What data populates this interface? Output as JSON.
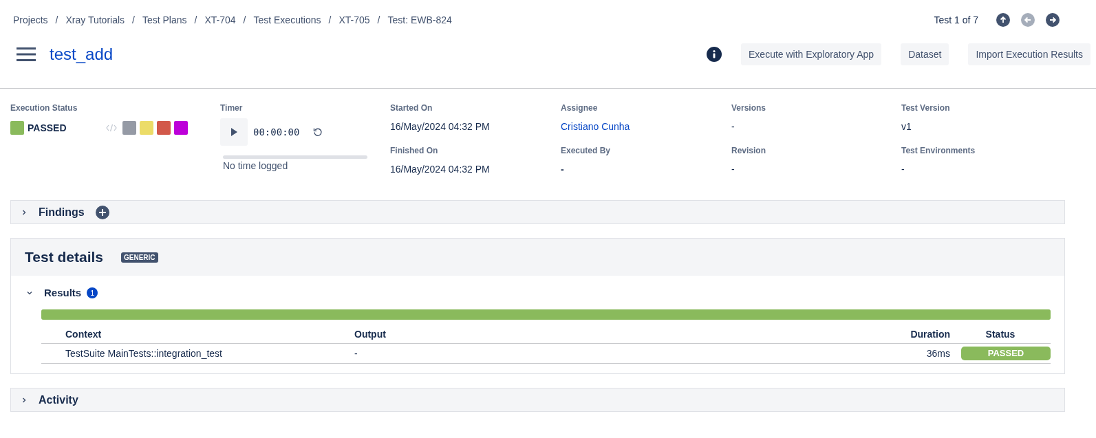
{
  "breadcrumbs": [
    {
      "label": "Projects"
    },
    {
      "separator": "/",
      "label": "Xray Tutorials"
    },
    {
      "separator": "/",
      "label": "Test Plans"
    },
    {
      "separator": "/",
      "label": "XT-704"
    },
    {
      "separator": "/",
      "label": "Test Executions"
    },
    {
      "separator": "/",
      "label": "XT-705"
    },
    {
      "separator": "/",
      "label": "Test: EWB-824"
    }
  ],
  "pager": {
    "label": "Test 1 of 7",
    "buttons": [
      {
        "kind": "up",
        "disabled": false
      },
      {
        "kind": "prev",
        "disabled": true
      },
      {
        "kind": "next",
        "disabled": false
      }
    ]
  },
  "title": "test_add",
  "actions": [
    "Execute with Exploratory App",
    "Dataset",
    "Import Execution Results"
  ],
  "execution_status": {
    "label": "Execution Status",
    "value": "PASSED",
    "color": "#8aba5c",
    "options": [
      {
        "color": "#959aa5"
      },
      {
        "color": "#ecdc68"
      },
      {
        "color": "#d2594a"
      },
      {
        "color": "#bd00d9"
      }
    ]
  },
  "timer": {
    "label": "Timer",
    "time": "00:00:00",
    "level": 0,
    "note": "No time logged"
  },
  "fields": [
    {
      "label": "Started On",
      "value": "16/May/2024 04:32 PM",
      "kind": "text"
    },
    {
      "label": "Assignee",
      "value": "Cristiano Cunha",
      "kind": "link"
    },
    {
      "label": "Versions",
      "value": "-",
      "kind": "text"
    },
    {
      "label": "Test Version",
      "value": "v1",
      "kind": "text"
    },
    {
      "label": "Finished On",
      "value": "16/May/2024 04:32 PM",
      "kind": "text"
    },
    {
      "label": "Executed By",
      "value": "-",
      "kind": "strong"
    },
    {
      "label": "Revision",
      "value": "-",
      "kind": "text"
    },
    {
      "label": "Test Environments",
      "value": "-",
      "kind": "text"
    }
  ],
  "findings": {
    "title": "Findings",
    "expanded": false
  },
  "test_details": {
    "title": "Test details",
    "badge": "GENERIC",
    "results": {
      "title": "Results",
      "count": "1",
      "expanded": true,
      "level": 1,
      "columns": [
        "Context",
        "Output",
        "Duration",
        "Status"
      ],
      "rows": [
        {
          "context": "TestSuite MainTests::integration_test",
          "output": "-",
          "duration": "36ms",
          "status": "PASSED",
          "color": "#8aba5c"
        }
      ]
    }
  },
  "activity": {
    "title": "Activity",
    "expanded": false
  }
}
